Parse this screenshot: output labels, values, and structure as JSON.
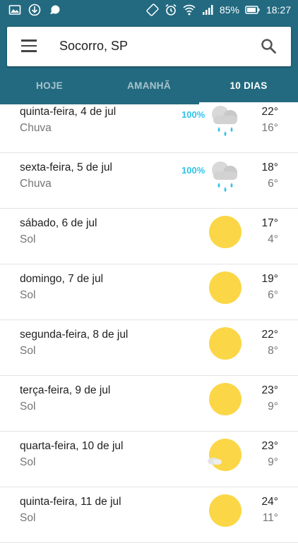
{
  "status_bar": {
    "battery": "85%",
    "time": "18:27"
  },
  "search": {
    "location": "Socorro, SP"
  },
  "tabs": [
    {
      "label": "HOJE"
    },
    {
      "label": "AMANHÃ"
    },
    {
      "label": "10 DIAS"
    }
  ],
  "colors": {
    "header": "#236a80",
    "precip": "#30c3e8",
    "sun": "#fbd747"
  },
  "forecast": [
    {
      "day": "quinta-feira, 4 de jul",
      "condition": "Chuva",
      "precip": "100%",
      "high": "22°",
      "low": "16°",
      "icon": "rain-icon"
    },
    {
      "day": "sexta-feira, 5 de jul",
      "condition": "Chuva",
      "precip": "100%",
      "high": "18°",
      "low": "6°",
      "icon": "rain-icon"
    },
    {
      "day": "sábado, 6 de jul",
      "condition": "Sol",
      "precip": "",
      "high": "17°",
      "low": "4°",
      "icon": "sun-icon"
    },
    {
      "day": "domingo, 7 de jul",
      "condition": "Sol",
      "precip": "",
      "high": "19°",
      "low": "6°",
      "icon": "sun-icon"
    },
    {
      "day": "segunda-feira, 8 de jul",
      "condition": "Sol",
      "precip": "",
      "high": "22°",
      "low": "8°",
      "icon": "sun-icon"
    },
    {
      "day": "terça-feira, 9 de jul",
      "condition": "Sol",
      "precip": "",
      "high": "23°",
      "low": "9°",
      "icon": "sun-icon"
    },
    {
      "day": "quarta-feira, 10 de jul",
      "condition": "Sol",
      "precip": "",
      "high": "23°",
      "low": "9°",
      "icon": "sun-small-cloud-icon"
    },
    {
      "day": "quinta-feira, 11 de jul",
      "condition": "Sol",
      "precip": "",
      "high": "24°",
      "low": "11°",
      "icon": "sun-icon"
    }
  ]
}
